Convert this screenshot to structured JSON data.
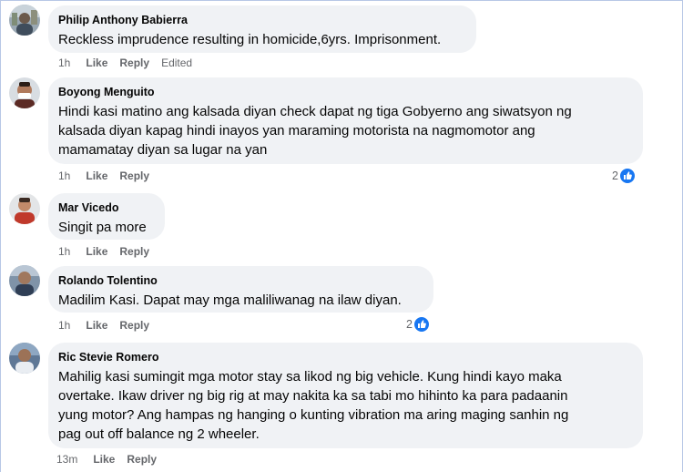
{
  "colors": {
    "bubble": "#f0f2f5",
    "meta_text": "#65676b",
    "like_blue": "#1877f2"
  },
  "comments": [
    {
      "author": "Philip Anthony Babierra",
      "lines": [
        "Reckless imprudence resulting in homicide,6yrs. Imprisonment."
      ],
      "time": "1h",
      "like": "Like",
      "reply": "Reply",
      "edited": "Edited"
    },
    {
      "author": "Boyong Menguito",
      "lines": [
        "Hindi kasi matino ang kalsada diyan check dapat ng tiga Gobyerno ang siwatsyon ng",
        "kalsada diyan kapag hindi inayos yan maraming motorista na nagmomotor ang",
        "mamamatay diyan sa lugar na yan"
      ],
      "time": "1h",
      "like": "Like",
      "reply": "Reply",
      "reaction_count": "2",
      "reaction_icon": "like-reaction-icon"
    },
    {
      "author": "Mar Vicedo",
      "lines": [
        "Singit pa more"
      ],
      "time": "1h",
      "like": "Like",
      "reply": "Reply"
    },
    {
      "author": "Rolando Tolentino",
      "lines": [
        "Madilim Kasi. Dapat may mga maliliwanag na ilaw diyan."
      ],
      "time": "1h",
      "like": "Like",
      "reply": "Reply",
      "reaction_count": "2",
      "reaction_icon": "like-reaction-icon"
    },
    {
      "author": "Ric Stevie Romero",
      "lines": [
        "Mahilig kasi sumingit mga motor stay sa likod ng big vehicle. Kung hindi kayo maka",
        "overtake. Ikaw driver ng big rig at may nakita ka sa tabi mo hihinto ka para padaanin",
        "yung motor? Ang hampas ng hanging o kunting vibration ma aring maging sanhin ng",
        "pag out off balance ng 2 wheeler."
      ],
      "time": "13m",
      "like": "Like",
      "reply": "Reply"
    }
  ]
}
